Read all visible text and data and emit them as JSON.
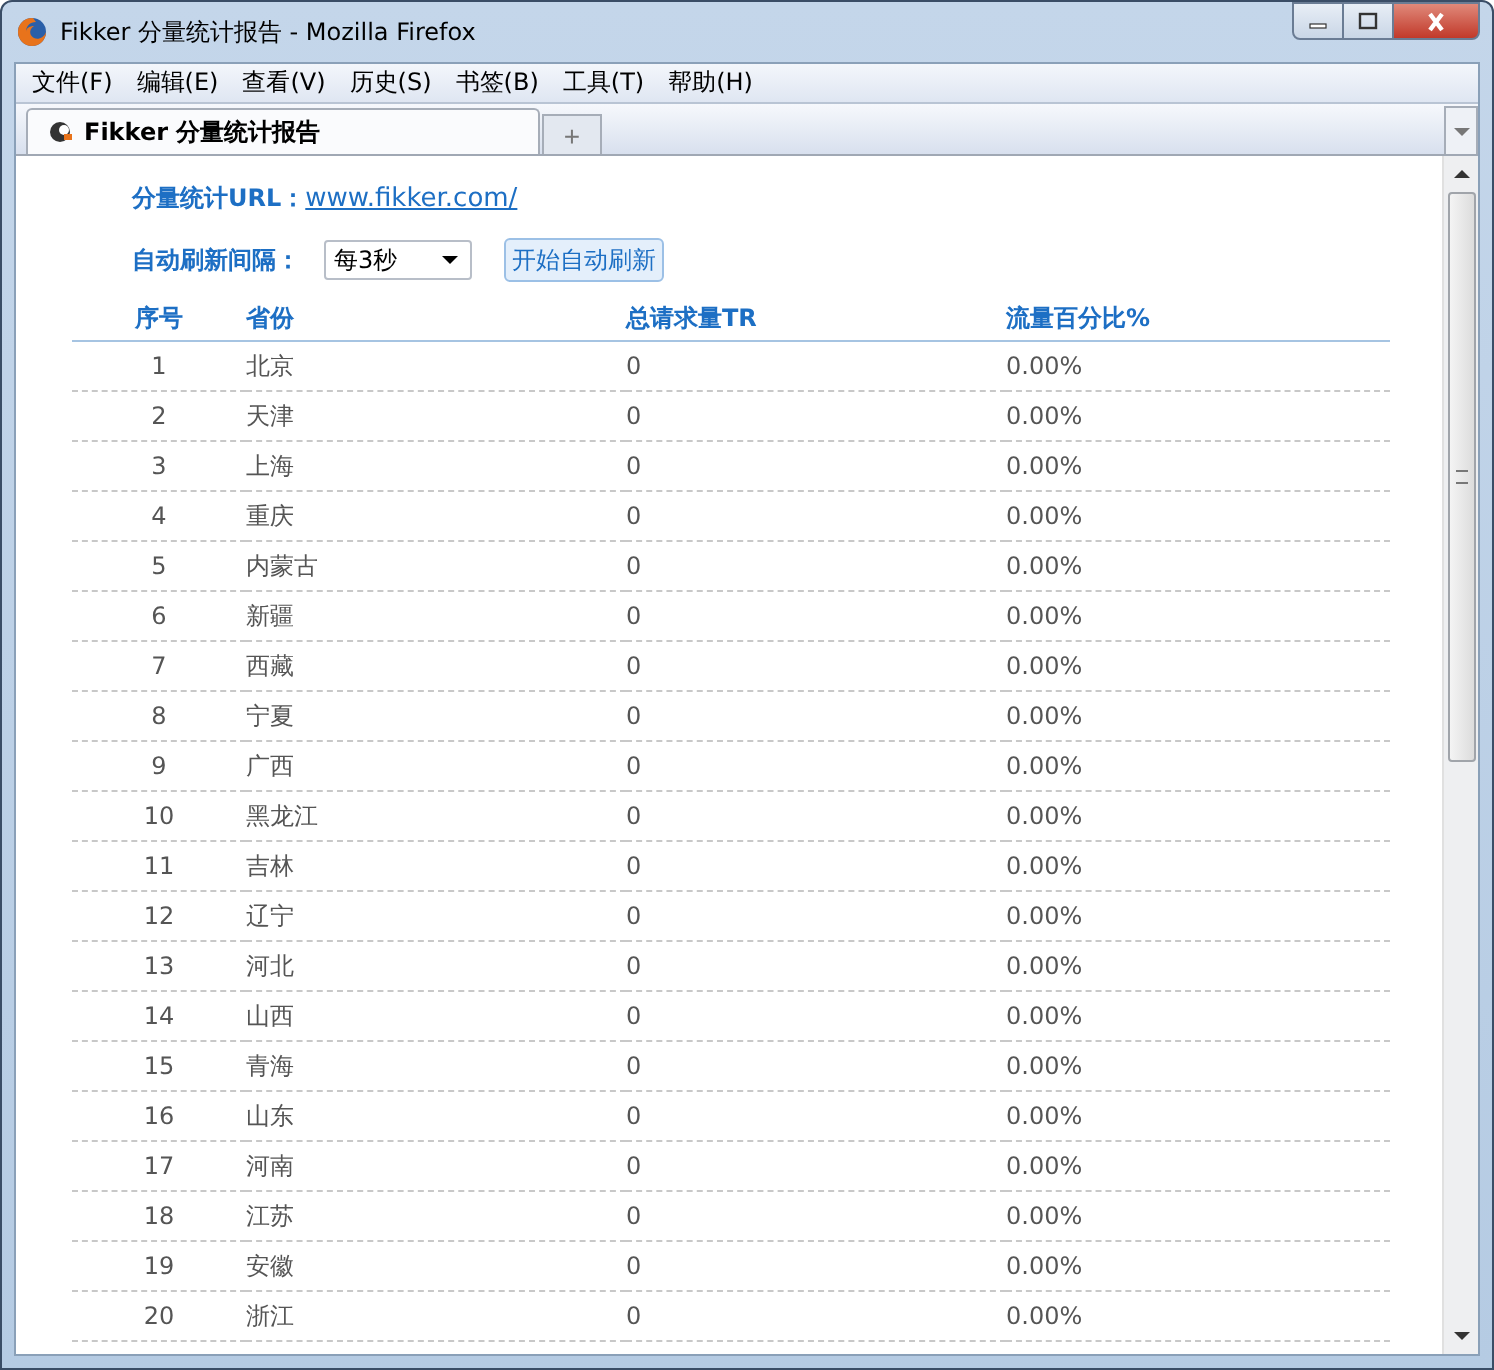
{
  "window": {
    "title": "Fikker 分量统计报告 - Mozilla Firefox"
  },
  "menu": [
    "文件(F)",
    "编辑(E)",
    "查看(V)",
    "历史(S)",
    "书签(B)",
    "工具(T)",
    "帮助(H)"
  ],
  "tabs": [
    {
      "label": "Fikker 分量统计报告",
      "selected": true
    }
  ],
  "new_tab": "+",
  "url_label": "分量统计URL：",
  "url": "www.fikker.com/",
  "interval_label": "自动刷新间隔：",
  "interval_value": "每3秒",
  "start_button": "开始自动刷新",
  "table": {
    "columns": [
      "序号",
      "省份",
      "总请求量TR",
      "流量百分比%"
    ],
    "rows": [
      [
        "1",
        "北京",
        "0",
        "0.00%"
      ],
      [
        "2",
        "天津",
        "0",
        "0.00%"
      ],
      [
        "3",
        "上海",
        "0",
        "0.00%"
      ],
      [
        "4",
        "重庆",
        "0",
        "0.00%"
      ],
      [
        "5",
        "内蒙古",
        "0",
        "0.00%"
      ],
      [
        "6",
        "新疆",
        "0",
        "0.00%"
      ],
      [
        "7",
        "西藏",
        "0",
        "0.00%"
      ],
      [
        "8",
        "宁夏",
        "0",
        "0.00%"
      ],
      [
        "9",
        "广西",
        "0",
        "0.00%"
      ],
      [
        "10",
        "黑龙江",
        "0",
        "0.00%"
      ],
      [
        "11",
        "吉林",
        "0",
        "0.00%"
      ],
      [
        "12",
        "辽宁",
        "0",
        "0.00%"
      ],
      [
        "13",
        "河北",
        "0",
        "0.00%"
      ],
      [
        "14",
        "山西",
        "0",
        "0.00%"
      ],
      [
        "15",
        "青海",
        "0",
        "0.00%"
      ],
      [
        "16",
        "山东",
        "0",
        "0.00%"
      ],
      [
        "17",
        "河南",
        "0",
        "0.00%"
      ],
      [
        "18",
        "江苏",
        "0",
        "0.00%"
      ],
      [
        "19",
        "安徽",
        "0",
        "0.00%"
      ],
      [
        "20",
        "浙江",
        "0",
        "0.00%"
      ]
    ]
  }
}
